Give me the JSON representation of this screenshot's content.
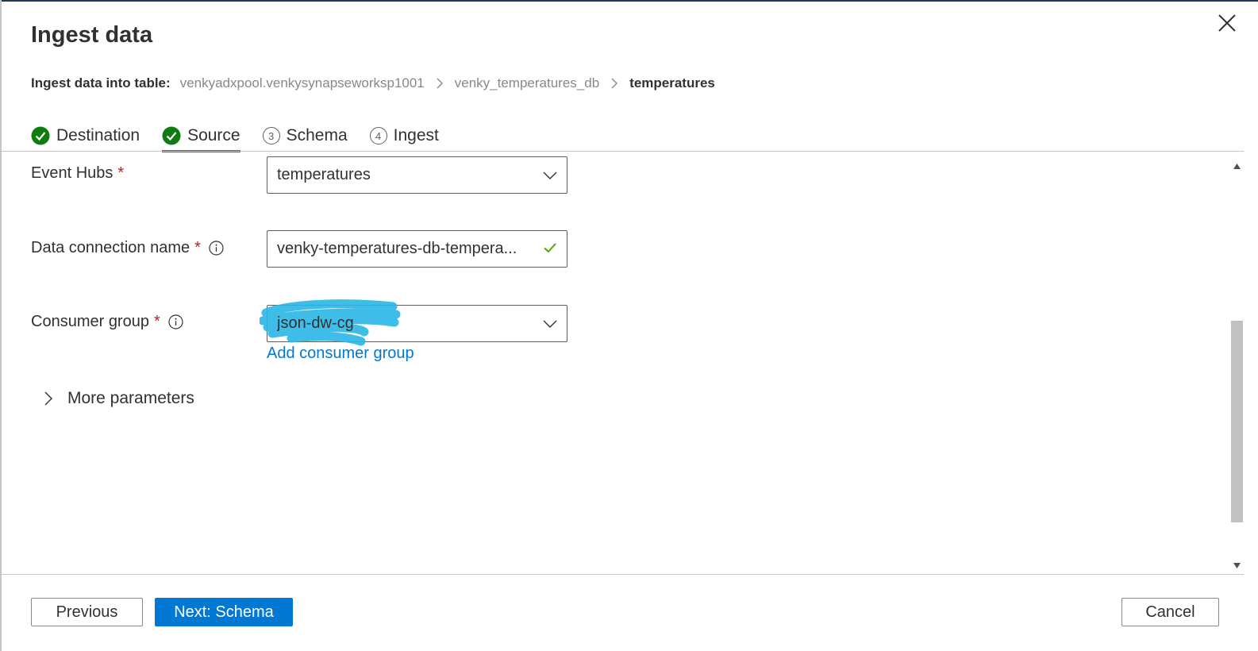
{
  "dialog": {
    "title": "Ingest data",
    "close_icon": "close-icon"
  },
  "breadcrumb": {
    "label": "Ingest data into table:",
    "items": [
      "venkyadxpool.venkysynapseworksp1001",
      "venky_temperatures_db"
    ],
    "current": "temperatures"
  },
  "tabs": [
    {
      "label": "Destination",
      "state": "completed",
      "icon": "check-circle-icon"
    },
    {
      "label": "Source",
      "state": "active",
      "icon": "check-circle-icon"
    },
    {
      "label": "Schema",
      "state": "pending",
      "step": "3"
    },
    {
      "label": "Ingest",
      "state": "pending",
      "step": "4"
    }
  ],
  "form": {
    "event_hubs": {
      "label": "Event Hubs",
      "required": "*",
      "value": "temperatures"
    },
    "data_connection": {
      "label": "Data connection name",
      "required": "*",
      "value": "venky-temperatures-db-tempera..."
    },
    "consumer_group": {
      "label": "Consumer group",
      "required": "*",
      "value": "json-dw-cg"
    },
    "add_consumer_group": "Add consumer group",
    "more_parameters": "More parameters"
  },
  "footer": {
    "previous": "Previous",
    "next": "Next: Schema",
    "cancel": "Cancel"
  },
  "colors": {
    "accent": "#0078d4",
    "success": "#107c10",
    "required": "#a4262c",
    "highlight_scribble": "#29b6e6"
  }
}
